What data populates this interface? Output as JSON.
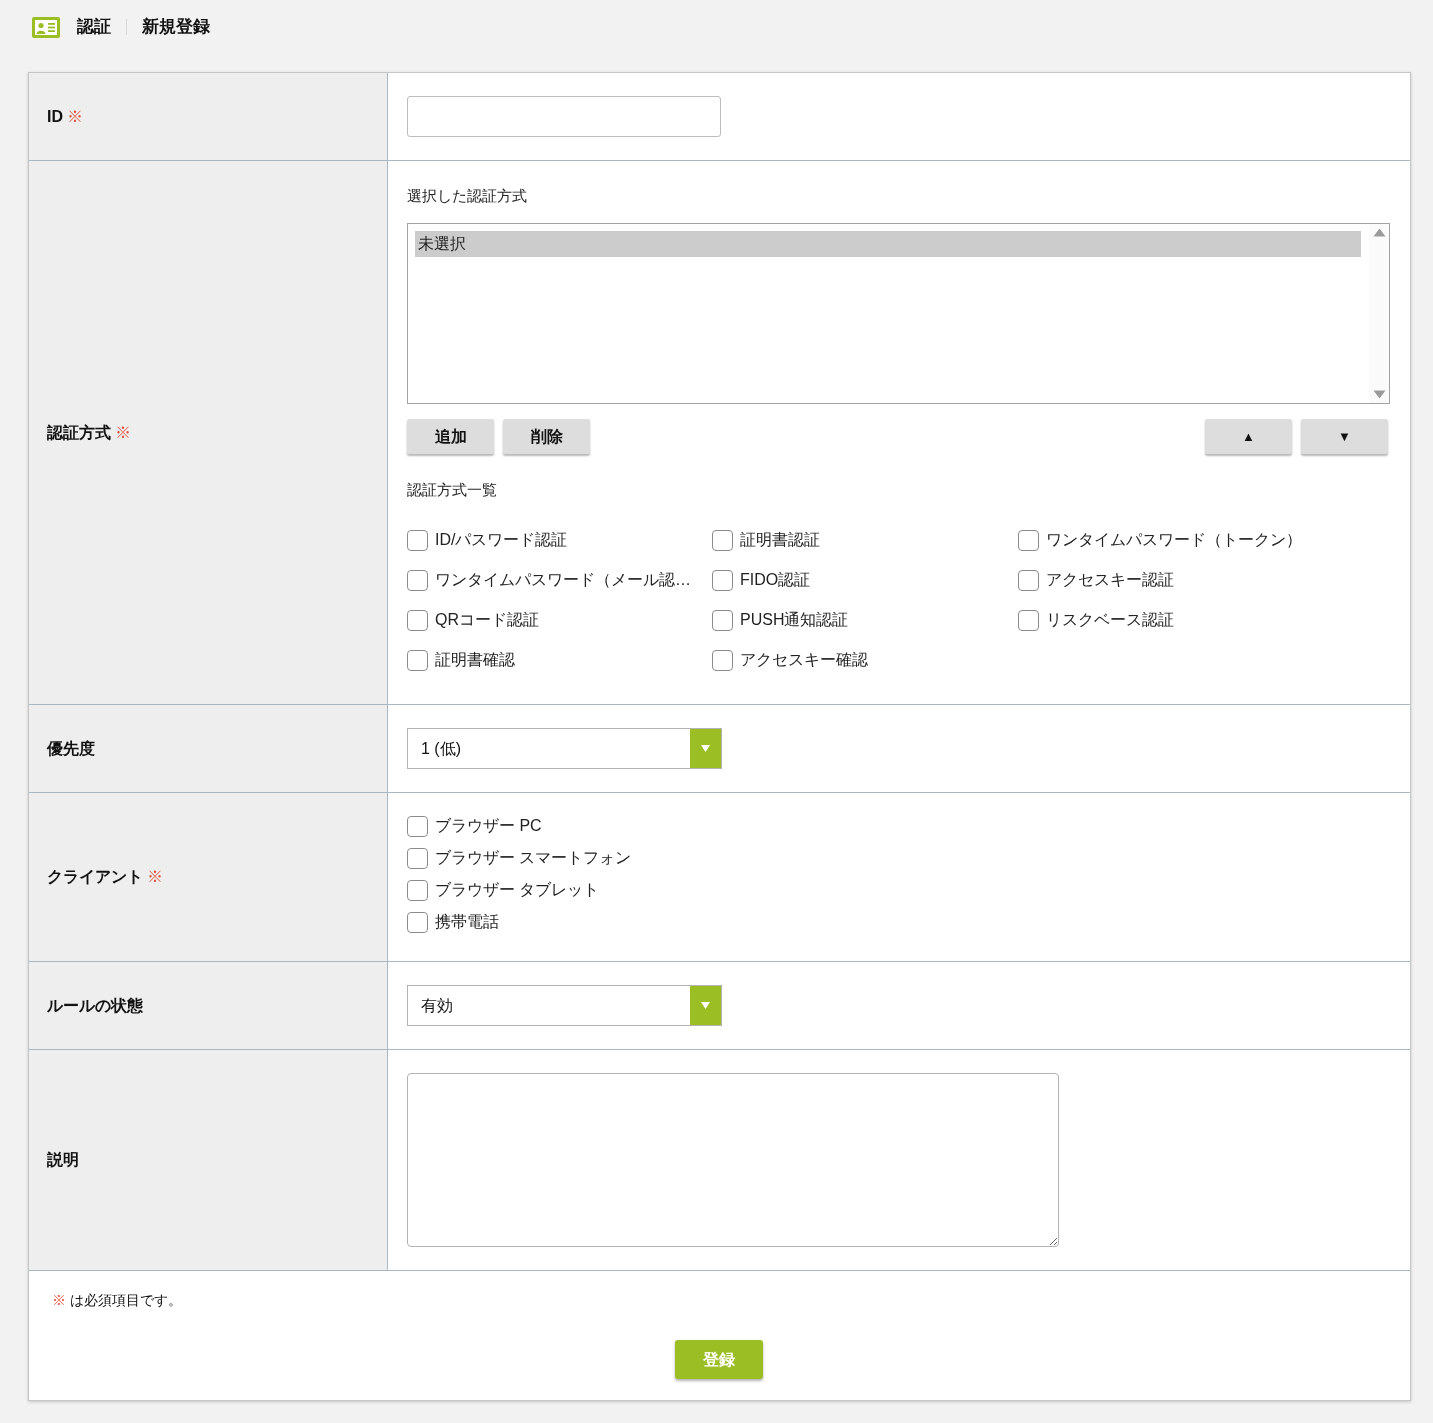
{
  "header": {
    "section": "認証",
    "page": "新規登録"
  },
  "form": {
    "rows": [
      {
        "kind": "input",
        "label": "ID",
        "required_mark": "※"
      },
      {
        "kind": "methods",
        "label": "認証方式",
        "required_mark": "※",
        "selected_caption": "選択した認証方式",
        "selected_list": [
          {
            "text": "未選択",
            "selected": true
          }
        ],
        "list_buttons": [
          "追加",
          "削除"
        ],
        "order_buttons": [
          "▲",
          "▼"
        ],
        "catalog_caption": "認証方式一覧",
        "options": [
          {
            "label": "ID/パスワード認証",
            "checked": false
          },
          {
            "label": "証明書認証",
            "checked": false
          },
          {
            "label": "ワンタイムパスワード（トークン）",
            "checked": false
          },
          {
            "label": "ワンタイムパスワード（メール認…",
            "checked": false
          },
          {
            "label": "FIDO認証",
            "checked": false
          },
          {
            "label": "アクセスキー認証",
            "checked": false
          },
          {
            "label": "QRコード認証",
            "checked": false
          },
          {
            "label": "PUSH通知認証",
            "checked": false
          },
          {
            "label": "リスクベース認証",
            "checked": false
          },
          {
            "label": "証明書確認",
            "checked": false
          },
          {
            "label": "アクセスキー確認",
            "checked": false
          }
        ]
      },
      {
        "kind": "select",
        "label": "優先度",
        "value": "1 (低)"
      },
      {
        "kind": "checks",
        "label": "クライアント",
        "required_mark": "※",
        "options": [
          {
            "label": "ブラウザー PC",
            "checked": false
          },
          {
            "label": "ブラウザー スマートフォン",
            "checked": false
          },
          {
            "label": "ブラウザー タブレット",
            "checked": false
          },
          {
            "label": "携帯電話",
            "checked": false
          }
        ]
      },
      {
        "kind": "select",
        "label": "ルールの状態",
        "value": "有効"
      },
      {
        "kind": "textarea",
        "label": "説明"
      }
    ]
  },
  "footer": {
    "note_mark": "※",
    "note": "は必須項目です。",
    "submit": "登録"
  }
}
